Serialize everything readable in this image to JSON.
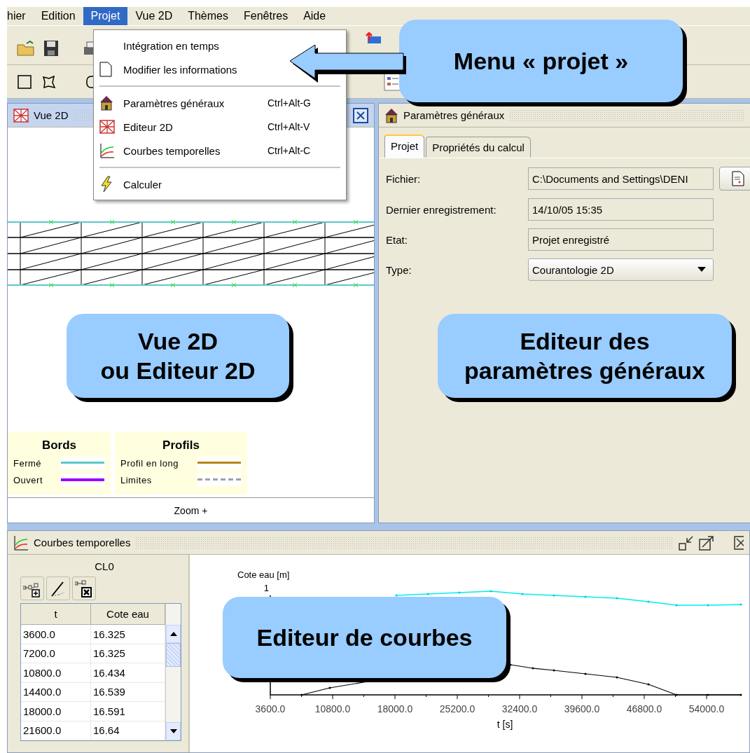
{
  "menubar": {
    "items": [
      {
        "label": "hier",
        "selected": false
      },
      {
        "label": "Edition",
        "selected": false
      },
      {
        "label": "Projet",
        "selected": true
      },
      {
        "label": "Vue 2D",
        "selected": false
      },
      {
        "label": "Thèmes",
        "selected": false
      },
      {
        "label": "Fenêtres",
        "selected": false
      },
      {
        "label": "Aide",
        "selected": false
      }
    ]
  },
  "projet_menu": {
    "groups": [
      [
        {
          "label": "Intégration en temps"
        },
        {
          "label": "Modifier les informations"
        }
      ],
      [
        {
          "label": "Paramètres généraux",
          "shortcut": "Ctrl+Alt-G"
        },
        {
          "label": "Editeur 2D",
          "shortcut": "Ctrl+Alt-V"
        },
        {
          "label": "Courbes temporelles",
          "shortcut": "Ctrl+Alt-C"
        }
      ],
      [
        {
          "label": "Calculer"
        }
      ]
    ]
  },
  "vue2d_panel": {
    "title": "Vue 2D",
    "legend": [
      {
        "title": "Bords",
        "items": [
          {
            "label": "Fermé",
            "color": "#5cc8c8",
            "kind": "solid"
          },
          {
            "label": "Ouvert",
            "color": "#9900ff",
            "kind": "solid"
          }
        ]
      },
      {
        "title": "Profils",
        "items": [
          {
            "label": "Profil en long",
            "color": "#b8860b",
            "kind": "solid"
          },
          {
            "label": "Limites",
            "color": "#a0a0a0",
            "kind": "dashed"
          }
        ]
      }
    ],
    "zoom_button": "Zoom +"
  },
  "parametres_panel": {
    "title": "Paramètres généraux",
    "tabs": [
      {
        "label": "Projet",
        "selected": true
      },
      {
        "label": "Propriétés du calcul",
        "selected": false
      }
    ],
    "fields": [
      {
        "label": "Fichier:",
        "value": "C:\\Documents and Settings\\DENI",
        "kind": "file"
      },
      {
        "label": "Dernier enregistrement:",
        "value": "14/10/05 15:35",
        "kind": "text"
      },
      {
        "label": "Etat:",
        "value": "Projet enregistré",
        "kind": "text"
      },
      {
        "label": "Type:",
        "value": "Courantologie 2D",
        "kind": "select"
      }
    ]
  },
  "courbes_panel": {
    "title": "Courbes temporelles",
    "curve_name": "CL0",
    "table": {
      "columns": [
        "t",
        "Cote eau"
      ],
      "rows": [
        [
          "3600.0",
          "16.325"
        ],
        [
          "7200.0",
          "16.325"
        ],
        [
          "10800.0",
          "16.434"
        ],
        [
          "14400.0",
          "16.539"
        ],
        [
          "18000.0",
          "16.591"
        ],
        [
          "21600.0",
          "16.64"
        ]
      ]
    },
    "chart": {
      "ylabel": "Cote eau [m]",
      "ytick": "1",
      "xticks": [
        "3600.0",
        "10800.0",
        "18000.0",
        "25200.0",
        "32400.0",
        "39600.0",
        "46800.0",
        "54000.0"
      ],
      "xlabel": "t [s]"
    }
  },
  "callouts": [
    {
      "text": "Menu « projet »",
      "kind": "arrow"
    },
    {
      "text": "Vue 2D\nou Editeur 2D",
      "kind": "plain"
    },
    {
      "text": "Editeur des\nparamètres généraux",
      "kind": "plain"
    },
    {
      "text": "Editeur de courbes",
      "kind": "plain"
    }
  ]
}
